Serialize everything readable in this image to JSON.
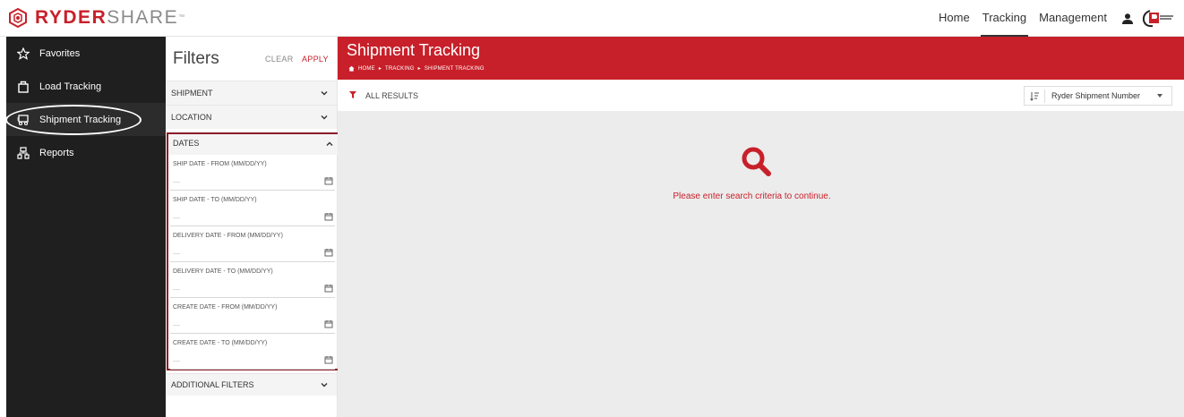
{
  "app": {
    "brand_primary": "RYDER",
    "brand_secondary": "SHARE",
    "brand_tm": "™",
    "brand_color": "#c8202a"
  },
  "topnav": {
    "items": [
      {
        "label": "Home",
        "active": false
      },
      {
        "label": "Tracking",
        "active": true
      },
      {
        "label": "Management",
        "active": false
      }
    ],
    "user_icon": "user-icon"
  },
  "sidebar": {
    "items": [
      {
        "label": "Favorites",
        "icon": "star-icon",
        "active": false
      },
      {
        "label": "Load Tracking",
        "icon": "package-icon",
        "active": false
      },
      {
        "label": "Shipment Tracking",
        "icon": "truck-icon",
        "active": true
      },
      {
        "label": "Reports",
        "icon": "reports-icon",
        "active": false
      }
    ]
  },
  "filters": {
    "title": "Filters",
    "clear_label": "CLEAR",
    "apply_label": "APPLY",
    "sections": {
      "shipment": "SHIPMENT",
      "location": "LOCATION",
      "dates": "DATES",
      "additional": "ADDITIONAL FILTERS"
    },
    "date_fields": [
      {
        "label": "SHIP DATE - FROM (MM/DD/YY)",
        "value": "—"
      },
      {
        "label": "SHIP DATE - TO (MM/DD/YY)",
        "value": "—"
      },
      {
        "label": "DELIVERY DATE - FROM (MM/DD/YY)",
        "value": "—"
      },
      {
        "label": "DELIVERY DATE - TO (MM/DD/YY)",
        "value": "—"
      },
      {
        "label": "CREATE DATE - FROM (MM/DD/YY)",
        "value": "—"
      },
      {
        "label": "CREATE DATE - TO (MM/DD/YY)",
        "value": "—"
      }
    ]
  },
  "main": {
    "title": "Shipment Tracking",
    "breadcrumb": [
      "HOME",
      "TRACKING",
      "SHIPMENT TRACKING"
    ],
    "results_label": "ALL RESULTS",
    "sort_value": "Ryder Shipment Number",
    "empty_message": "Please enter search criteria to continue."
  }
}
